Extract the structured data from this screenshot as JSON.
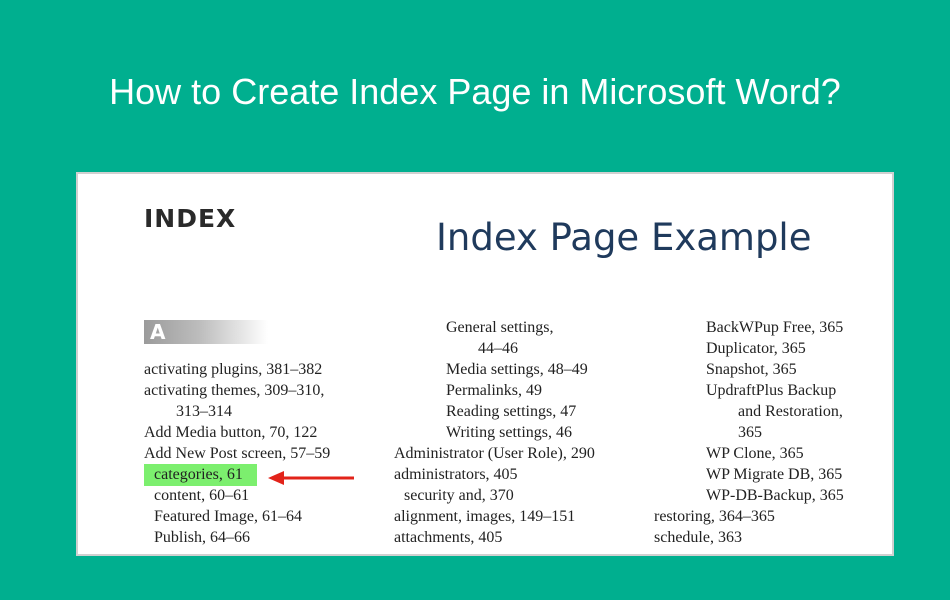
{
  "banner": {
    "title": "How to Create Index Page in Microsoft Word?"
  },
  "document": {
    "heading": "INDEX",
    "example_title": "Index Page Example",
    "letter": "A",
    "highlight_color": "#7cef6e",
    "arrow_color": "#e2231a",
    "column1": [
      "activating plugins, 381–382",
      "activating themes, 309–310,",
      "313–314",
      "Add Media button, 70, 122",
      "Add New Post screen, 57–59",
      "categories, 61",
      "content, 60–61",
      "Featured Image, 61–64",
      "Publish, 64–66"
    ],
    "column2": [
      "General settings,",
      "44–46",
      "Media settings, 48–49",
      "Permalinks, 49",
      "Reading settings, 47",
      "Writing settings, 46",
      "Administrator (User Role), 290",
      "administrators, 405",
      "security and, 370",
      "alignment, images, 149–151",
      "attachments, 405"
    ],
    "column3": [
      "BackWPup Free, 365",
      "Duplicator, 365",
      "Snapshot, 365",
      "UpdraftPlus Backup",
      "and Restoration,",
      "365",
      "WP Clone, 365",
      "WP Migrate DB, 365",
      "WP-DB-Backup, 365",
      "restoring, 364–365",
      "schedule, 363"
    ]
  }
}
